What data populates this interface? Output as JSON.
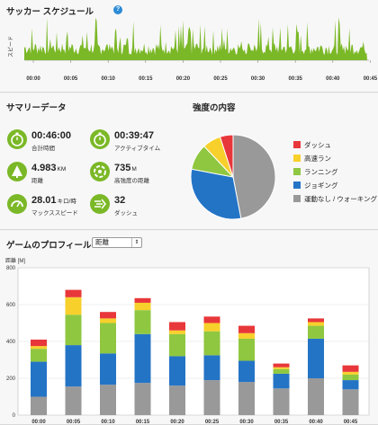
{
  "schedule": {
    "title": "サッカー スケジュール",
    "help_icon": "?",
    "y_label": "スピード",
    "ticks": [
      "00:00",
      "00:05",
      "00:10",
      "00:15",
      "00:20",
      "00:25",
      "00:30",
      "00:35",
      "00:40",
      "00:45"
    ]
  },
  "summary": {
    "title": "サマリーデータ",
    "metrics": [
      {
        "value": "00:46:00",
        "unit": "",
        "label": "合計時間",
        "icon": "stopwatch-icon"
      },
      {
        "value": "00:39:47",
        "unit": "",
        "label": "アクティブタイム",
        "icon": "stopwatch-icon"
      },
      {
        "value": "4.983",
        "unit": "KM",
        "label": "距離",
        "icon": "distance-icon"
      },
      {
        "value": "735",
        "unit": "M",
        "label": "高強度の距離",
        "icon": "high-intensity-distance-icon"
      },
      {
        "value": "28.01",
        "unit": "キロ/時",
        "label": "マックススピード",
        "icon": "speedometer-icon"
      },
      {
        "value": "32",
        "unit": "",
        "label": "ダッシュ",
        "icon": "sprint-icon"
      }
    ]
  },
  "intensity": {
    "title": "強度の内容",
    "legend": [
      {
        "label": "ダッシュ",
        "color": "#e8373a"
      },
      {
        "label": "高速ラン",
        "color": "#f7d02c"
      },
      {
        "label": "ランニング",
        "color": "#8fc740"
      },
      {
        "label": "ジョギング",
        "color": "#2474c6"
      },
      {
        "label": "運動なし / ウォーキング",
        "color": "#999999"
      }
    ]
  },
  "profile": {
    "title": "ゲームのプロフィール",
    "selected": "距離",
    "y_unit": "距離 [M]"
  },
  "chart_data": [
    {
      "type": "pie",
      "title": "強度の内容",
      "labels": [
        "ダッシュ",
        "高速ラン",
        "ランニング",
        "ジョギング",
        "運動なし / ウォーキング"
      ],
      "values": [
        5,
        7,
        10,
        31,
        47
      ],
      "colors": [
        "#e8373a",
        "#f7d02c",
        "#8fc740",
        "#2474c6",
        "#999999"
      ]
    },
    {
      "type": "bar",
      "stacked": true,
      "title": "ゲームのプロフィール",
      "ylabel": "距離 [M]",
      "ylim": [
        0,
        800
      ],
      "yticks": [
        0,
        200,
        400,
        600,
        800
      ],
      "categories": [
        "00:00",
        "00:05",
        "00:10",
        "00:15",
        "00:20",
        "00:25",
        "00:30",
        "00:35",
        "00:40",
        "00:45"
      ],
      "series": [
        {
          "name": "運動なし / ウォーキング",
          "color": "#999999",
          "values": [
            100,
            155,
            165,
            175,
            160,
            190,
            180,
            145,
            200,
            140
          ]
        },
        {
          "name": "ジョギング",
          "color": "#2474c6",
          "values": [
            190,
            225,
            170,
            265,
            160,
            135,
            115,
            80,
            215,
            50
          ]
        },
        {
          "name": "ランニング",
          "color": "#8fc740",
          "values": [
            70,
            165,
            165,
            130,
            120,
            130,
            120,
            25,
            70,
            30
          ]
        },
        {
          "name": "高速ラン",
          "color": "#f7d02c",
          "values": [
            15,
            95,
            25,
            40,
            20,
            45,
            30,
            10,
            20,
            15
          ]
        },
        {
          "name": "ダッシュ",
          "color": "#e8373a",
          "values": [
            35,
            40,
            35,
            25,
            45,
            35,
            40,
            20,
            20,
            35
          ]
        }
      ]
    }
  ]
}
